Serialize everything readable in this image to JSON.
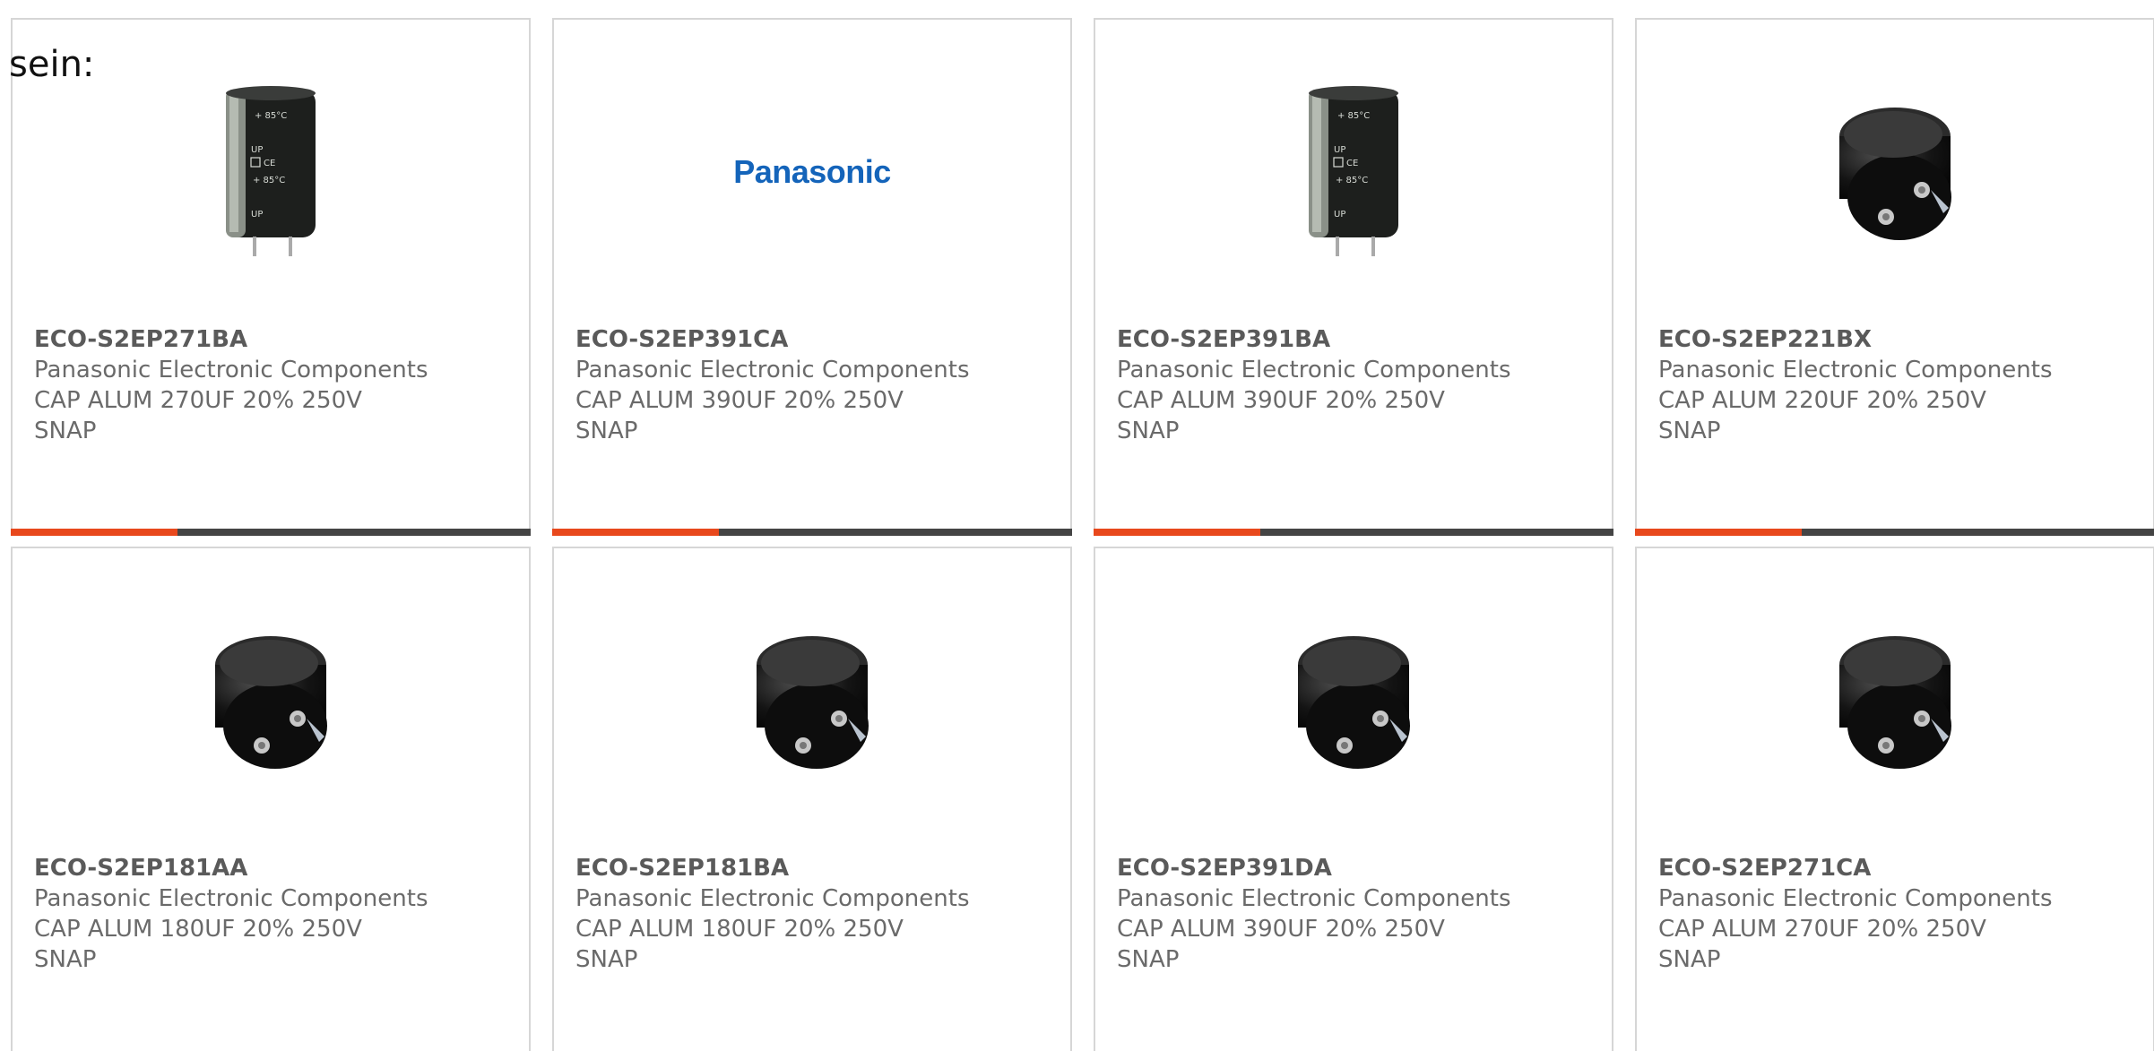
{
  "intro_text": "sein:",
  "colors": {
    "accent": "#e8481c",
    "bar_track": "#444444",
    "brand_blue": "#1464ba"
  },
  "products": [
    {
      "part": "ECO-S2EP271BA",
      "mfr": "Panasonic Electronic Components",
      "desc": "CAP ALUM 270UF 20% 250V SNAP",
      "image": "tall-capacitor",
      "progress": 0.32
    },
    {
      "part": "ECO-S2EP391CA",
      "mfr": "Panasonic Electronic Components",
      "desc": "CAP ALUM 390UF 20% 250V SNAP",
      "image": "panasonic-logo",
      "logo_text": "Panasonic",
      "progress": 0.32
    },
    {
      "part": "ECO-S2EP391BA",
      "mfr": "Panasonic Electronic Components",
      "desc": "CAP ALUM 390UF 20% 250V SNAP",
      "image": "tall-capacitor",
      "progress": 0.32
    },
    {
      "part": "ECO-S2EP221BX",
      "mfr": "Panasonic Electronic Components",
      "desc": "CAP ALUM 220UF 20% 250V SNAP",
      "image": "angled-capacitor",
      "progress": 0.32
    },
    {
      "part": "ECO-S2EP181AA",
      "mfr": "Panasonic Electronic Components",
      "desc": "CAP ALUM 180UF 20% 250V SNAP",
      "image": "angled-capacitor"
    },
    {
      "part": "ECO-S2EP181BA",
      "mfr": "Panasonic Electronic Components",
      "desc": "CAP ALUM 180UF 20% 250V SNAP",
      "image": "angled-capacitor"
    },
    {
      "part": "ECO-S2EP391DA",
      "mfr": "Panasonic Electronic Components",
      "desc": "CAP ALUM 390UF 20% 250V SNAP",
      "image": "angled-capacitor"
    },
    {
      "part": "ECO-S2EP271CA",
      "mfr": "Panasonic Electronic Components",
      "desc": "CAP ALUM 270UF 20% 250V SNAP",
      "image": "angled-capacitor"
    }
  ]
}
